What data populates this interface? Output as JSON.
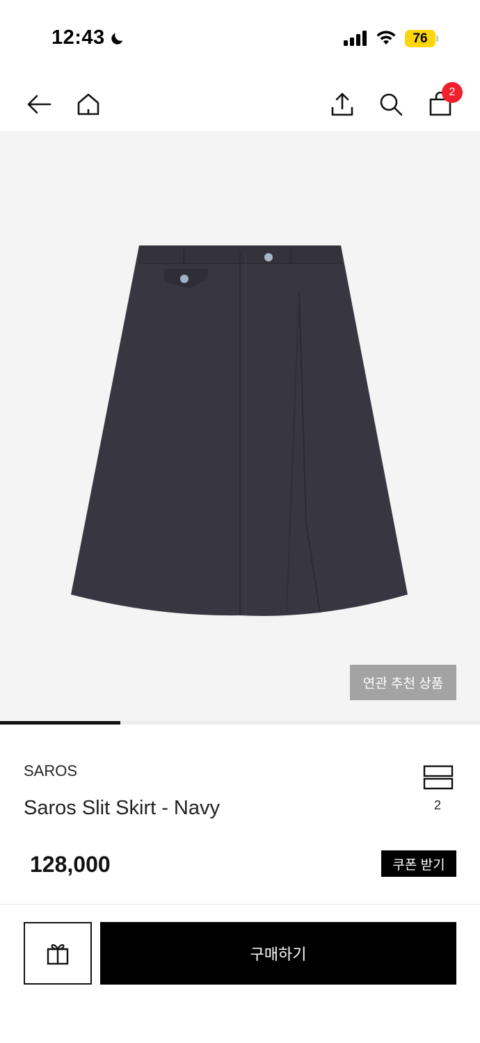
{
  "status_bar": {
    "time": "12:43",
    "battery_level": "76",
    "icons": [
      "moon-icon",
      "signal-icon",
      "wifi-icon",
      "battery-icon"
    ],
    "battery_color": "#ffd60a"
  },
  "nav": {
    "icons": [
      "back-arrow-icon",
      "home-icon",
      "share-icon",
      "search-icon",
      "shopping-bag-icon"
    ],
    "cart_count": "2",
    "badge_color": "#f0212d"
  },
  "gallery": {
    "related_products_label": "연관 추천 상품",
    "image_progress": 0.25
  },
  "product": {
    "brand": "SAROS",
    "name": "Saros Slit Skirt - Navy",
    "option_count": "2",
    "price": "128,000",
    "coupon_label": "쿠폰 받기"
  },
  "bottom_bar": {
    "gift_icon": "gift-icon",
    "buy_label": "구매하기"
  }
}
